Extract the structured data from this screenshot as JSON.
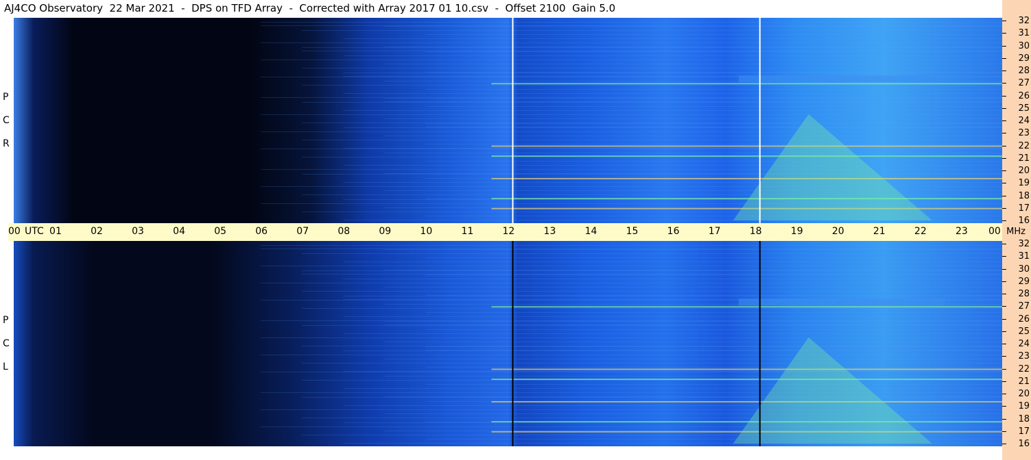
{
  "title": "AJ4CO Observatory  22 Mar 2021  -  DPS on TFD Array  -  Corrected with Array 2017 01 10.csv  -  Offset 2100  Gain 5.0",
  "panels": [
    {
      "id": "rcp",
      "letters": [
        "P",
        "C",
        "R"
      ]
    },
    {
      "id": "lcp",
      "letters": [
        "P",
        "C",
        "L"
      ]
    }
  ],
  "colors": {
    "background_dark": "#020614",
    "spectrum_blue": "#1a5ee0",
    "spectrum_green": "#7ef0a0",
    "axis_strip": "#fffbc8",
    "freq_strip": "#fcd6b4",
    "marker_white": "#ffffff",
    "marker_black": "#000000"
  },
  "chart_data": {
    "type": "heatmap",
    "x_axis": {
      "unit_label": "UTC",
      "ticks": [
        "00",
        "01",
        "02",
        "03",
        "04",
        "05",
        "06",
        "07",
        "08",
        "09",
        "10",
        "11",
        "12",
        "13",
        "14",
        "15",
        "16",
        "17",
        "18",
        "19",
        "20",
        "21",
        "22",
        "23",
        "00"
      ],
      "range": [
        0,
        24
      ]
    },
    "y_axis": {
      "unit_label": "MHz",
      "ticks": [
        "32",
        "31",
        "30",
        "29",
        "28",
        "27",
        "26",
        "25",
        "24",
        "23",
        "22",
        "21",
        "20",
        "19",
        "18",
        "17",
        "16"
      ],
      "range": [
        16,
        32
      ]
    },
    "markers_hours": [
      12.1,
      18.1
    ],
    "bright_lines_mhz": [
      17.0,
      17.8,
      19.4,
      21.2,
      22.0,
      27.0
    ]
  }
}
